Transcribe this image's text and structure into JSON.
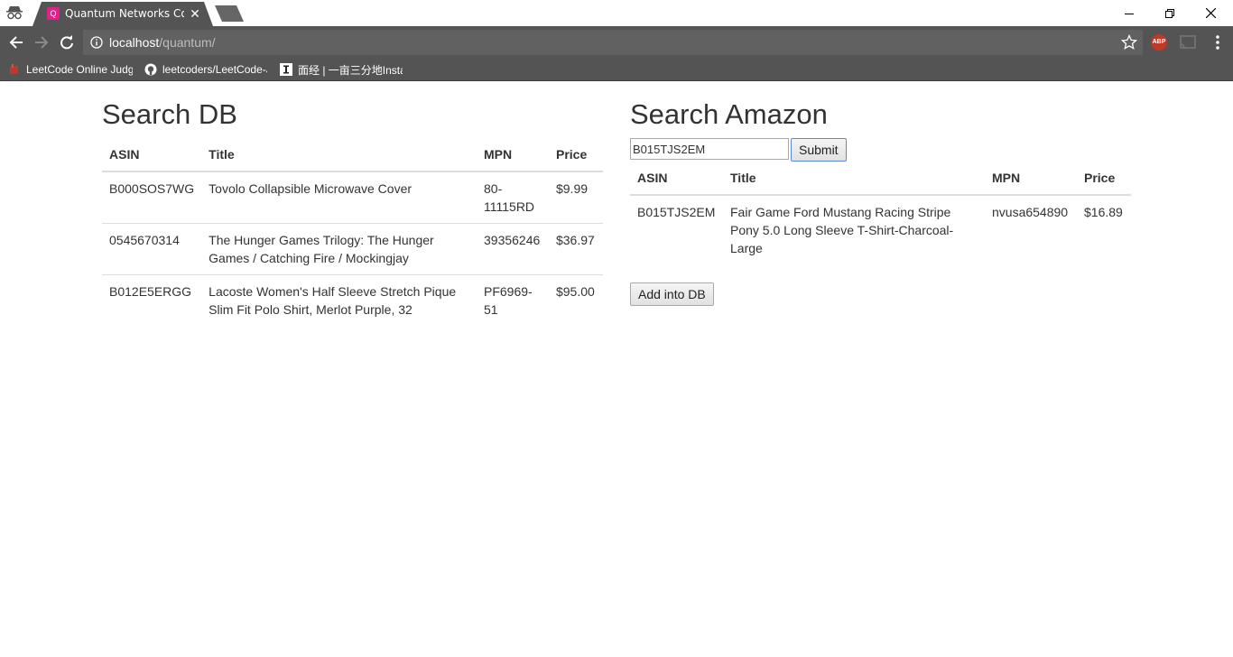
{
  "browser": {
    "tab_title": "Quantum Networks Coding",
    "url_host": "localhost",
    "url_path": "/quantum/",
    "bookmarks": [
      {
        "label": "LeetCode Online Judge",
        "icon": "leetcode-icon"
      },
      {
        "label": "leetcoders/LeetCode-Java",
        "icon": "github-icon"
      },
      {
        "label": "面经 | 一亩三分地Instant",
        "icon": "instant-icon"
      }
    ],
    "extension_abp": "ABP"
  },
  "search_db": {
    "heading": "Search DB",
    "columns": [
      "ASIN",
      "Title",
      "MPN",
      "Price"
    ],
    "rows": [
      {
        "asin": "B000SOS7WG",
        "title": "Tovolo Collapsible Microwave Cover",
        "mpn": "80-11115RD",
        "price": "$9.99"
      },
      {
        "asin": "0545670314",
        "title": "The Hunger Games Trilogy: The Hunger Games / Catching Fire / Mockingjay",
        "mpn": "39356246",
        "price": "$36.97"
      },
      {
        "asin": "B012E5ERGG",
        "title": "Lacoste Women's Half Sleeve Stretch Pique Slim Fit Polo Shirt, Merlot Purple, 32",
        "mpn": "PF6969-51",
        "price": "$95.00"
      }
    ]
  },
  "search_amazon": {
    "heading": "Search Amazon",
    "input_value": "B015TJS2EM",
    "submit_label": "Submit",
    "columns": [
      "ASIN",
      "Title",
      "MPN",
      "Price"
    ],
    "rows": [
      {
        "asin": "B015TJS2EM",
        "title": "Fair Game Ford Mustang Racing Stripe Pony 5.0 Long Sleeve T-Shirt-Charcoal-Large",
        "mpn": "nvusa654890",
        "price": "$16.89"
      }
    ],
    "add_label": "Add into DB"
  },
  "colors": {
    "chrome_toolbar": "#545454",
    "omnibox": "#616161",
    "text": "#333333",
    "border": "#dddddd"
  }
}
